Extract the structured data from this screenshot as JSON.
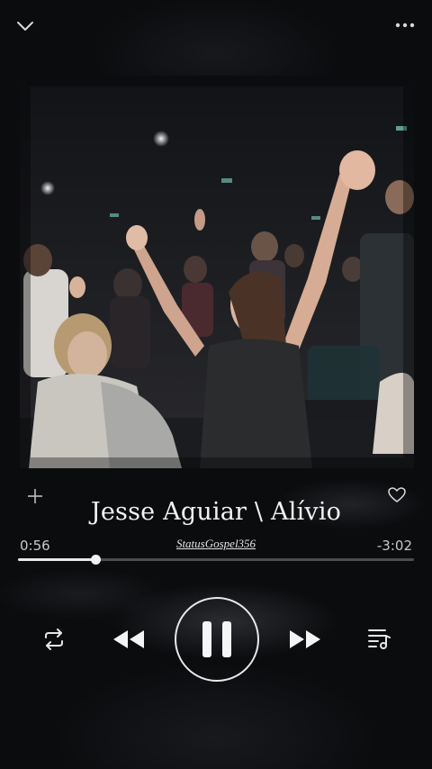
{
  "player": {
    "track_title": "Jesse Aguiar \\ Alívio",
    "artist_handle": "StatusGospel356",
    "elapsed": "0:56",
    "remaining": "-3:02",
    "progress": 0.195,
    "state": "playing"
  },
  "icons": {
    "collapse": "chevron-down-icon",
    "more": "more-options-icon",
    "add": "plus-icon",
    "like": "heart-icon",
    "repeat": "repeat-icon",
    "previous": "rewind-icon",
    "pause": "pause-icon",
    "next": "fast-forward-icon",
    "queue": "queue-icon"
  },
  "colors": {
    "background": "#0b0c0e",
    "text": "#f2f2f2",
    "secondary_text": "#c9c9cc"
  }
}
